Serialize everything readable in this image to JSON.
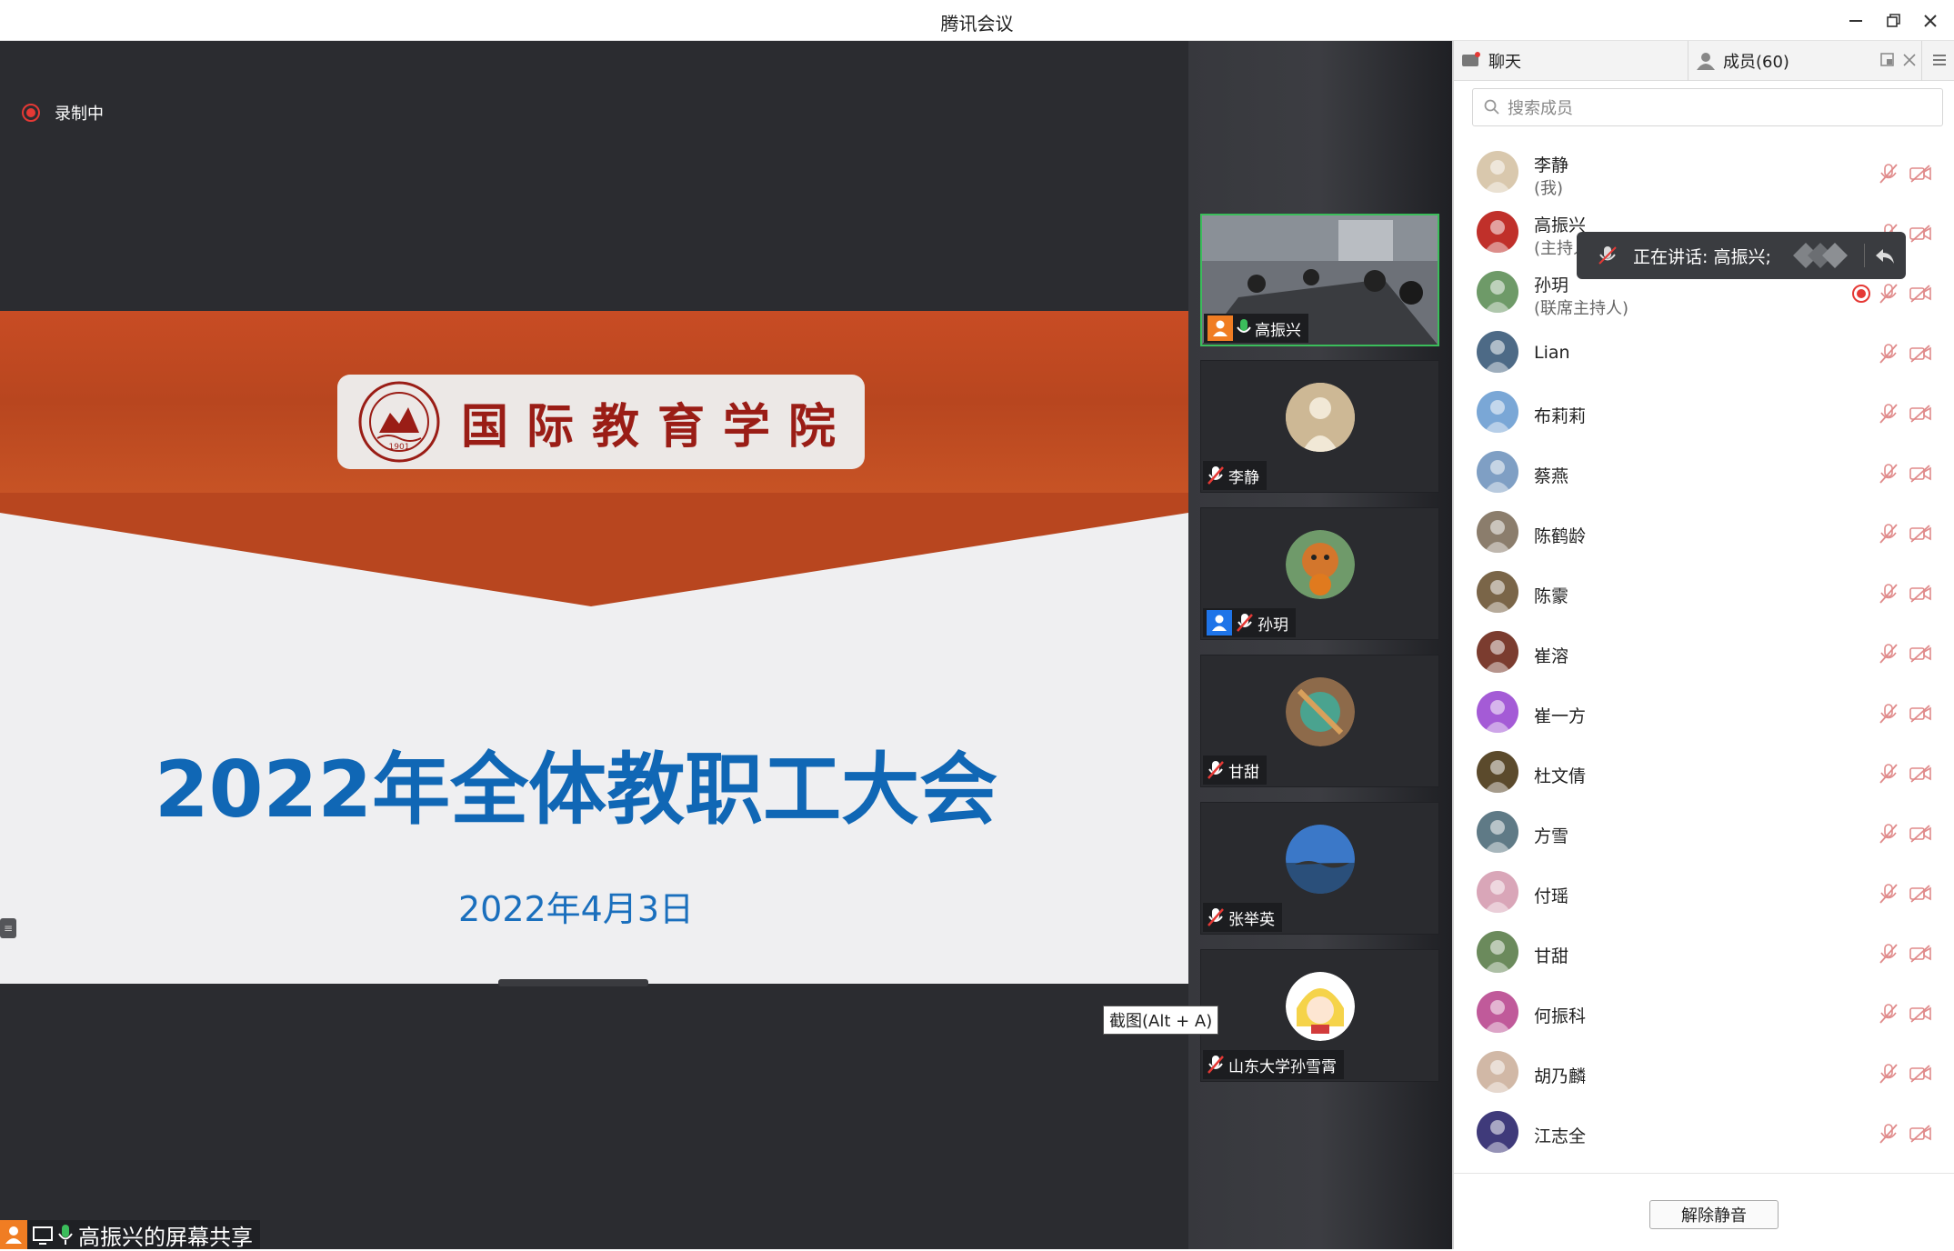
{
  "window": {
    "title": "腾讯会议"
  },
  "recording": {
    "label": "录制中"
  },
  "slide": {
    "logo_text": "国际教育学院",
    "seal_text": "1901",
    "title": "2022年全体教职工大会",
    "date": "2022年4月3日"
  },
  "share": {
    "label": "高振兴的屏幕共享"
  },
  "tiles": [
    {
      "name": "高振兴",
      "host": true,
      "mic": "on",
      "active": true,
      "kind": "video"
    },
    {
      "name": "李静",
      "host": false,
      "mic": "muted",
      "active": false,
      "kind": "avatar"
    },
    {
      "name": "孙玥",
      "host": true,
      "mic": "muted",
      "active": false,
      "kind": "avatar"
    },
    {
      "name": "甘甜",
      "host": false,
      "mic": "muted",
      "active": false,
      "kind": "avatar"
    },
    {
      "name": "张举英",
      "host": false,
      "mic": "muted",
      "active": false,
      "kind": "avatar"
    },
    {
      "name": "山东大学孙雪霄",
      "host": false,
      "mic": "muted",
      "active": false,
      "kind": "avatar"
    }
  ],
  "screenshot_tip": "截图(Alt + A)",
  "panel": {
    "tab_chat": "聊天",
    "tab_members": "成员(60)",
    "search_placeholder": "搜索成员",
    "speaking_tooltip": "正在讲话: 高振兴;",
    "unmute_button": "解除静音"
  },
  "members": [
    {
      "name": "李静",
      "role": "(我)",
      "recording": false
    },
    {
      "name": "高振兴",
      "role": "(主持人)",
      "recording": false
    },
    {
      "name": "孙玥",
      "role": "(联席主持人)",
      "recording": true
    },
    {
      "name": "Lian",
      "role": "",
      "recording": false
    },
    {
      "name": "布莉莉",
      "role": "",
      "recording": false
    },
    {
      "name": "蔡燕",
      "role": "",
      "recording": false
    },
    {
      "name": "陈鹤龄",
      "role": "",
      "recording": false
    },
    {
      "name": "陈霥",
      "role": "",
      "recording": false
    },
    {
      "name": "崔溶",
      "role": "",
      "recording": false
    },
    {
      "name": "崔一方",
      "role": "",
      "recording": false
    },
    {
      "name": "杜文倩",
      "role": "",
      "recording": false
    },
    {
      "name": "方雪",
      "role": "",
      "recording": false
    },
    {
      "name": "付瑶",
      "role": "",
      "recording": false
    },
    {
      "name": "甘甜",
      "role": "",
      "recording": false
    },
    {
      "name": "何振科",
      "role": "",
      "recording": false
    },
    {
      "name": "胡乃麟",
      "role": "",
      "recording": false
    },
    {
      "name": "江志全",
      "role": "",
      "recording": false
    }
  ],
  "colors": {
    "accent_green": "#3bbd5b",
    "slide_blue": "#1067b5",
    "slide_red": "#c84c24",
    "record_red": "#e53935"
  }
}
